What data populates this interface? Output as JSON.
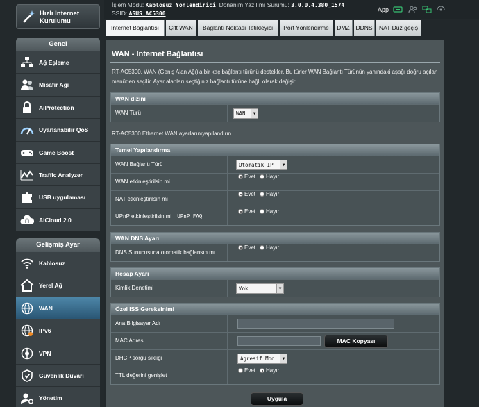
{
  "topbar": {
    "mode_label": "İşlem Modu:",
    "mode_value": "Kablosuz Yönlendirici",
    "firmware_label": "Donanım Yazılımı Sürümü:",
    "firmware_value": "3.0.0.4.380_1574",
    "ssid_label": "SSID:",
    "ssid_value": "ASUS_AC5300",
    "app_label": "App",
    "icons": [
      "usb-icon",
      "users-icon",
      "network-icon",
      "settings-icon"
    ]
  },
  "sidebar": {
    "quick_label_1": "Hızlı Internet",
    "quick_label_2": "Kurulumu",
    "general_header": "Genel",
    "general_items": [
      {
        "label": "Ağ Eşleme",
        "icon": "network-map-icon"
      },
      {
        "label": "Misafir Ağı",
        "icon": "guest-network-icon"
      },
      {
        "label": "AiProtection",
        "icon": "lock-icon"
      },
      {
        "label": "Uyarlanabilir QoS",
        "icon": "speedometer-icon"
      },
      {
        "label": "Game Boost",
        "icon": "gamepad-icon"
      },
      {
        "label": "Traffic Analyzer",
        "icon": "traffic-chart-icon"
      },
      {
        "label": "USB uygulaması",
        "icon": "puzzle-icon"
      },
      {
        "label": "AiCloud 2.0",
        "icon": "cloud-icon"
      }
    ],
    "advanced_header": "Gelişmiş Ayar",
    "advanced_items": [
      {
        "label": "Kablosuz",
        "icon": "wifi-icon"
      },
      {
        "label": "Yerel Ağ",
        "icon": "home-icon"
      },
      {
        "label": "WAN",
        "icon": "globe-icon"
      },
      {
        "label": "IPv6",
        "icon": "ipv6-globe-icon"
      },
      {
        "label": "VPN",
        "icon": "vpn-icon"
      },
      {
        "label": "Güvenlik Duvarı",
        "icon": "firewall-icon"
      },
      {
        "label": "Yönetim",
        "icon": "admin-icon"
      }
    ]
  },
  "tabs": [
    "Internet Bağlantısı",
    "Çift WAN",
    "Bağlantı Noktası Tetikleyici",
    "Port Yönlendirme",
    "DMZ",
    "DDNS",
    "NAT Duz geçiş"
  ],
  "main": {
    "title": "WAN - Internet Bağlantısı",
    "description": "RT-AC5300, WAN (Geniş Alan Ağı)'a bir kaç bağlantı türünü destekler. Bu türler WAN Bağlantı Türünün yanındaki aşağı doğru açılan menüden seçilir. Ayar alanları seçtiğiniz bağlantı türüne bağlı olarak değişir.",
    "wan_index": {
      "header": "WAN dizini",
      "wan_type_label": "WAN Türü",
      "wan_type_value": "WAN"
    },
    "ethernet_note": "RT-AC5300 Ethernet WAN ayarlarınıyapılandırın.",
    "basic": {
      "header": "Temel Yapılandırma",
      "conn_type_label": "WAN Bağlantı Türü",
      "conn_type_value": "Otomatik IP",
      "wan_enable_label": "WAN etkinleştirilsin mi",
      "nat_enable_label": "NAT etkinleştirilsin mi",
      "upnp_enable_label": "UPnP etkinleştirilsin mi",
      "upnp_faq": "UPnP FAQ",
      "yes": "Evet",
      "no": "Hayır"
    },
    "dns": {
      "header": "WAN DNS Ayarı",
      "auto_dns_label": "DNS Sunucusuna otomatik bağlansın mı",
      "yes": "Evet",
      "no": "Hayır"
    },
    "account": {
      "header": "Hesap Ayarı",
      "auth_label": "Kimlik Denetimi",
      "auth_value": "Yok"
    },
    "isp": {
      "header": "Özel ISS Gereksinimi",
      "host_label": "Ana Bilgisayar Adı",
      "host_value": "",
      "mac_label": "MAC Adresi",
      "mac_value": "",
      "mac_clone_button": "MAC Kopyası",
      "dhcp_label": "DHCP sorgu sıklığı",
      "dhcp_value": "Agresif Mod",
      "ttl_label": "TTL değerini genişlet",
      "yes": "Evet",
      "no": "Hayır"
    },
    "apply_button": "Uygula"
  }
}
